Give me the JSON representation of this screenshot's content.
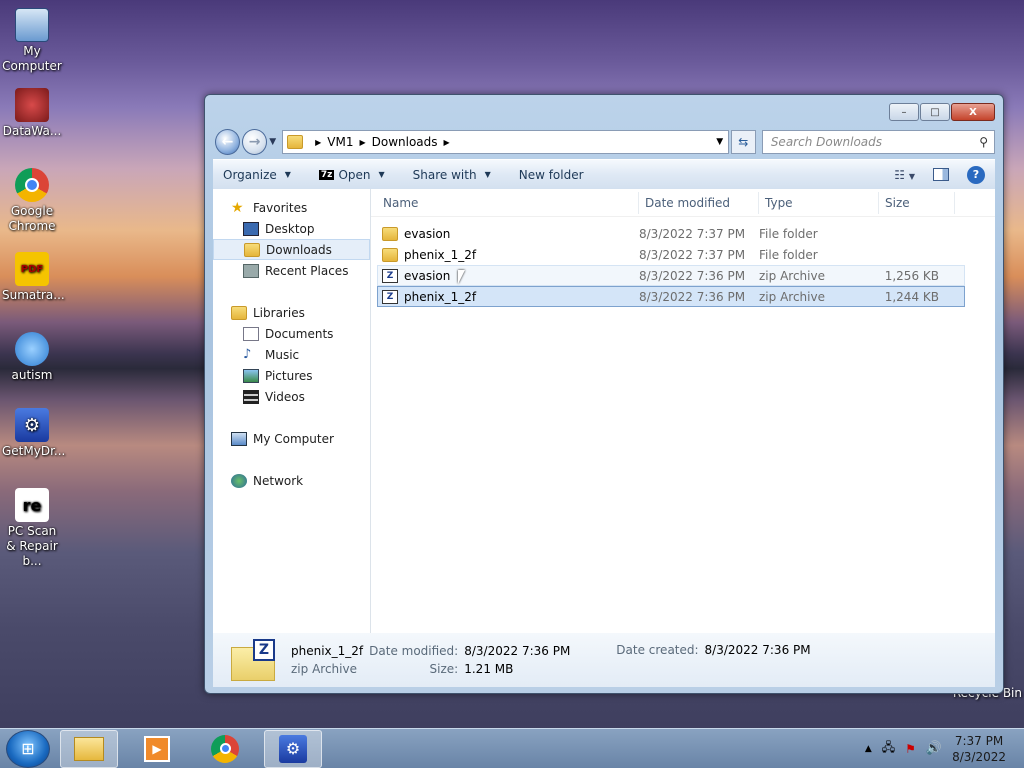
{
  "desktop_icons": [
    {
      "label": "My Computer",
      "icon": "computer-icon"
    },
    {
      "label": "DataWa...",
      "icon": "datawa-icon"
    },
    {
      "label": "Google Chrome",
      "icon": "chrome-icon"
    },
    {
      "label": "Sumatra...",
      "icon": "pdf-icon"
    },
    {
      "label": "autism",
      "icon": "autism-icon"
    },
    {
      "label": "GetMyDr...",
      "icon": "getmydr-icon"
    },
    {
      "label": "PC Scan & Repair b...",
      "icon": "re-icon"
    }
  ],
  "recycle_bin": "Recycle Bin",
  "window": {
    "controls": {
      "minimize": "–",
      "maximize": "□",
      "close": "X"
    },
    "address": {
      "parts": [
        "VM1",
        "Downloads"
      ]
    },
    "search": {
      "placeholder": "Search Downloads"
    },
    "toolbar": {
      "organize": "Organize",
      "open": "Open",
      "share_with": "Share with",
      "new_folder": "New folder"
    },
    "nav": {
      "favorites": "Favorites",
      "desktop": "Desktop",
      "downloads": "Downloads",
      "recent_places": "Recent Places",
      "libraries": "Libraries",
      "documents": "Documents",
      "music": "Music",
      "pictures": "Pictures",
      "videos": "Videos",
      "my_computer": "My Computer",
      "network": "Network"
    },
    "columns": {
      "name": "Name",
      "date": "Date modified",
      "type": "Type",
      "size": "Size"
    },
    "files": [
      {
        "name": "evasion",
        "date": "8/3/2022 7:37 PM",
        "type": "File folder",
        "size": "",
        "kind": "folder"
      },
      {
        "name": "phenix_1_2f",
        "date": "8/3/2022 7:37 PM",
        "type": "File folder",
        "size": "",
        "kind": "folder"
      },
      {
        "name": "evasion",
        "date": "8/3/2022 7:36 PM",
        "type": "zip Archive",
        "size": "1,256 KB",
        "kind": "zip"
      },
      {
        "name": "phenix_1_2f",
        "date": "8/3/2022 7:36 PM",
        "type": "zip Archive",
        "size": "1,244 KB",
        "kind": "zip"
      }
    ],
    "details": {
      "name": "phenix_1_2f",
      "type": "zip Archive",
      "date_modified_label": "Date modified:",
      "date_modified": "8/3/2022 7:36 PM",
      "size_label": "Size:",
      "size": "1.21 MB",
      "date_created_label": "Date created:",
      "date_created": "8/3/2022 7:36 PM"
    }
  },
  "taskbar": {
    "time": "7:37 PM",
    "date": "8/3/2022"
  }
}
